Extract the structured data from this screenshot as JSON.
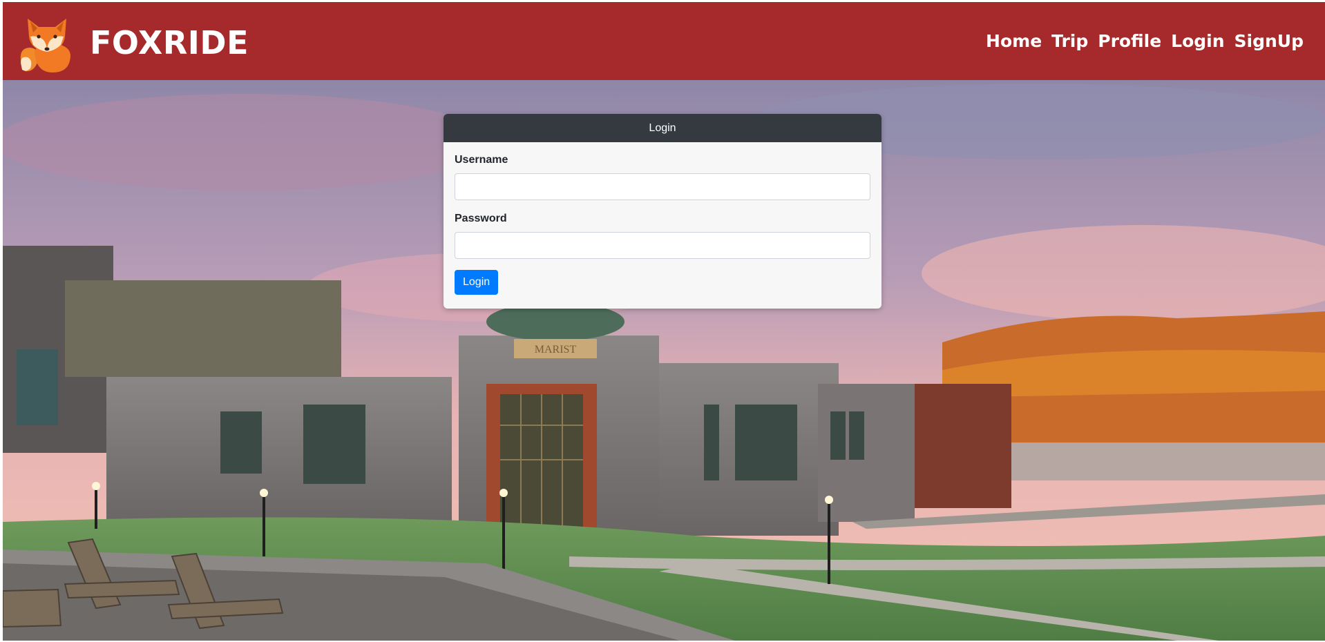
{
  "brand": {
    "name": "FOXRIDE",
    "logo_icon": "fox-logo-icon"
  },
  "nav": {
    "items": [
      {
        "label": "Home"
      },
      {
        "label": "Trip"
      },
      {
        "label": "Profile"
      },
      {
        "label": "Login"
      },
      {
        "label": "SignUp"
      }
    ]
  },
  "login_form": {
    "title": "Login",
    "username_label": "Username",
    "username_value": "",
    "password_label": "Password",
    "password_value": "",
    "submit_label": "Login"
  },
  "hero": {
    "building_sign": "MARIST"
  },
  "colors": {
    "navbar": "#a62a2b",
    "card_header": "#343a40",
    "primary_button": "#007bff",
    "card_body": "#f7f7f7"
  }
}
